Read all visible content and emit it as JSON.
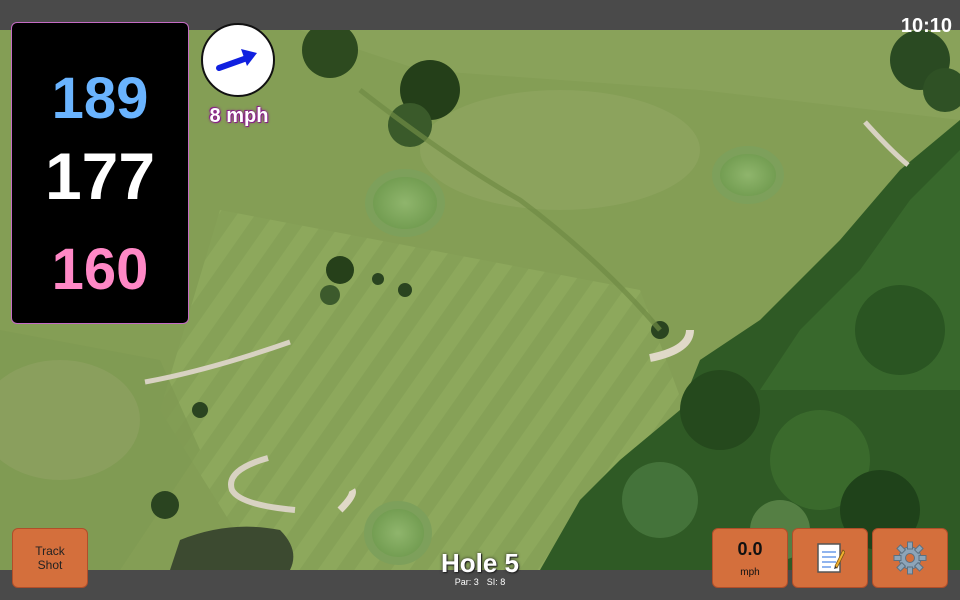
{
  "status": {
    "clock": "10:10"
  },
  "distances": {
    "back": "189",
    "middle": "177",
    "front": "160"
  },
  "wind": {
    "speed_label": "8 mph",
    "direction_icon": "arrow-icon"
  },
  "buttons": {
    "track_shot_line1": "Track",
    "track_shot_line2": "Shot",
    "speed_value": "0.0",
    "speed_unit": "mph",
    "notes_icon": "notepad-icon",
    "settings_icon": "gear-icon"
  },
  "hole": {
    "title": "Hole 5",
    "par_label": "Par: 3",
    "si_label": "SI: 8"
  },
  "colors": {
    "back_distance": "#6ab4ff",
    "middle_distance": "#ffffff",
    "front_distance": "#ff88c6",
    "button": "#d46f3c",
    "wind_arrow": "#1020e0"
  }
}
